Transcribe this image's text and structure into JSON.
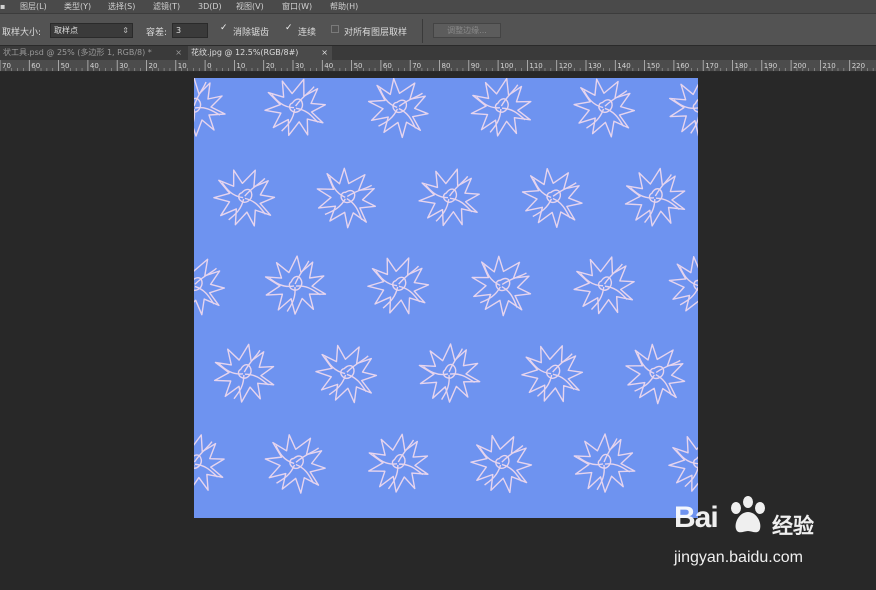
{
  "menu": {
    "items": [
      {
        "id": "i0",
        "label": "图层(L)"
      },
      {
        "id": "i1",
        "label": "类型(Y)"
      },
      {
        "id": "i2",
        "label": "选择(S)"
      },
      {
        "id": "i3",
        "label": "滤镜(T)"
      },
      {
        "id": "i4",
        "label": "3D(D)"
      },
      {
        "id": "i5",
        "label": "视图(V)"
      },
      {
        "id": "i6",
        "label": "窗口(W)"
      },
      {
        "id": "i7",
        "label": "帮助(H)"
      }
    ]
  },
  "options": {
    "sample_size_label": "取样大小:",
    "sample_size_value": "取样点",
    "tolerance_label": "容差:",
    "tolerance_value": "3",
    "anti_alias_label": "消除锯齿",
    "anti_alias_checked": true,
    "contiguous_label": "连续",
    "contiguous_checked": true,
    "all_layers_label": "对所有图层取样",
    "all_layers_checked": false,
    "refine_edge_label": "调整边缘..."
  },
  "tabs": [
    {
      "id": "t0",
      "label": "状工具.psd @ 25% (多边形 1, RGB/8) *",
      "close": "×",
      "active": false
    },
    {
      "id": "t1",
      "label": "花纹.jpg @ 12.5%(RGB/8#)",
      "close": "×",
      "active": true
    }
  ],
  "ruler": {
    "ticks": [
      "70",
      "60",
      "50",
      "40",
      "30",
      "20",
      "10",
      "0",
      "10",
      "20",
      "30",
      "40",
      "50",
      "60",
      "70",
      "80",
      "90",
      "100",
      "110",
      "120",
      "130",
      "140",
      "150",
      "160",
      "170",
      "180",
      "190",
      "200",
      "210",
      "220",
      "230"
    ]
  },
  "document": {
    "background_color": "#6e93f0",
    "pattern_color": "#e6d4ee"
  },
  "watermark": {
    "brand": "Bai",
    "brand2": "经验",
    "url": "jingyan.baidu.com"
  }
}
